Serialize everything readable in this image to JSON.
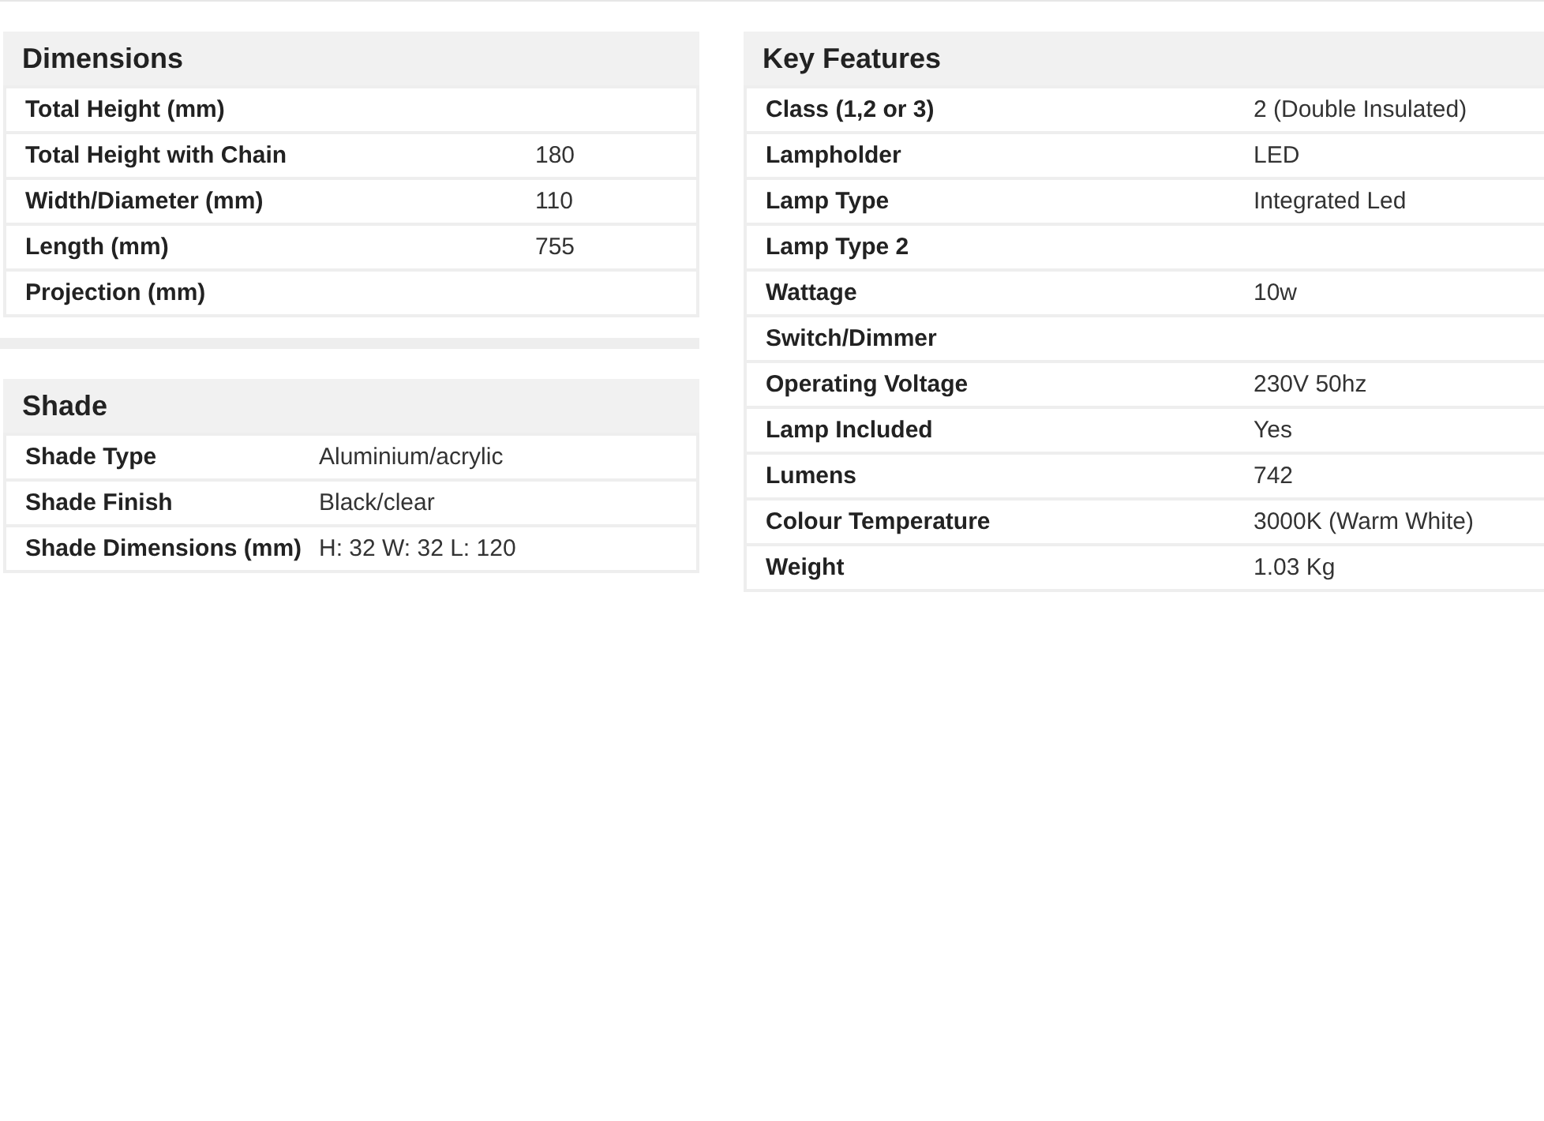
{
  "dimensions": {
    "title": "Dimensions",
    "rows": [
      {
        "label": "Total Height (mm)"
      },
      {
        "label": "Total Height with Chain",
        "value": "180"
      },
      {
        "label": "Width/Diameter (mm)",
        "value": "110"
      },
      {
        "label": "Length (mm)",
        "value": "755"
      },
      {
        "label": "Projection (mm)"
      }
    ]
  },
  "shade": {
    "title": "Shade",
    "rows": [
      {
        "label": "Shade Type",
        "value": "Aluminium/acrylic"
      },
      {
        "label": "Shade Finish",
        "value": "Black/clear"
      },
      {
        "label": "Shade Dimensions (mm)",
        "value": "H: 32 W: 32 L: 120"
      }
    ]
  },
  "key_features": {
    "title": "Key Features",
    "rows": [
      {
        "label": "Class (1,2 or 3)",
        "value": "2 (Double Insulated)"
      },
      {
        "label": "Lampholder",
        "value": "LED"
      },
      {
        "label": "Lamp Type",
        "value": "Integrated Led"
      },
      {
        "label": "Lamp Type 2"
      },
      {
        "label": "Wattage",
        "value": "10w"
      },
      {
        "label": "Switch/Dimmer"
      },
      {
        "label": "Operating Voltage",
        "value": "230V 50hz"
      },
      {
        "label": "Lamp Included",
        "value": "Yes"
      },
      {
        "label": "Lumens",
        "value": "742"
      },
      {
        "label": "Colour Temperature",
        "value": "3000K (Warm White)"
      },
      {
        "label": "Weight",
        "value": "1.03 Kg"
      }
    ]
  }
}
